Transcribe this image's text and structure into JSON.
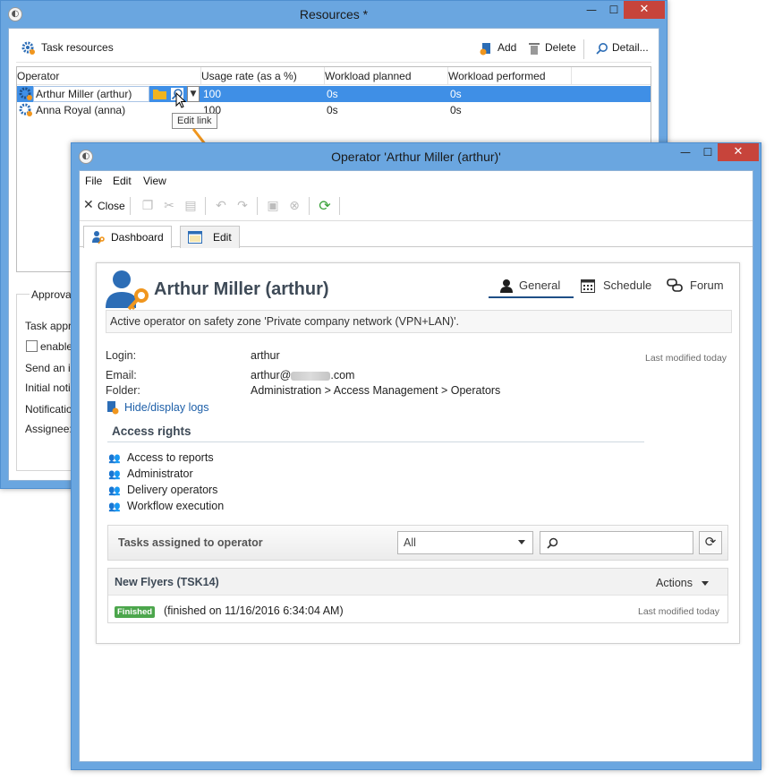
{
  "resources_window": {
    "title": "Resources *",
    "toolbar": {
      "task_resources": "Task resources",
      "add": "Add",
      "delete": "Delete",
      "detail": "Detail..."
    },
    "columns": [
      "Operator",
      "Usage rate (as a %)",
      "Workload planned",
      "Workload performed"
    ],
    "rows": [
      {
        "operator": "Arthur Miller (arthur)",
        "usage": "100",
        "planned": "0s",
        "performed": "0s"
      },
      {
        "operator": "Anna Royal (anna)",
        "usage": "100",
        "planned": "0s",
        "performed": "0s"
      }
    ],
    "tooltip": "Edit link",
    "approval": {
      "group": "Approval s",
      "task_appr": "Task appr",
      "enable": "enable",
      "send": "Send an in",
      "initial": "Initial noti",
      "notification": "Notificatio",
      "assignee": "Assignee:"
    }
  },
  "operator_window": {
    "title": "Operator 'Arthur Miller (arthur)'",
    "menu": [
      "File",
      "Edit",
      "View"
    ],
    "toolbar": {
      "close": "Close"
    },
    "tabs": {
      "dashboard": "Dashboard",
      "edit": "Edit"
    },
    "dashboard": {
      "name": "Arthur Miller (arthur)",
      "nav": {
        "general": "General",
        "schedule": "Schedule",
        "forum": "Forum"
      },
      "status": "Active operator on safety zone 'Private company network (VPN+LAN)'.",
      "login_label": "Login:",
      "login_value": "arthur",
      "last_modified": "Last modified today",
      "email_label": "Email:",
      "email_prefix": "arthur@",
      "email_suffix": ".com",
      "folder_label": "Folder:",
      "folder_value": "Administration > Access Management > Operators",
      "logs_link": "Hide/display logs",
      "access_rights_title": "Access rights",
      "access_rights": [
        "Access to reports",
        "Administrator",
        "Delivery operators",
        "Workflow execution"
      ],
      "tasks_title": "Tasks assigned to operator",
      "filter_value": "All",
      "task": {
        "name": "New Flyers (TSK14)",
        "actions": "Actions",
        "status_badge": "Finished",
        "finished_text": "(finished on 11/16/2016 6:34:04 AM)",
        "last_modified": "Last modified today"
      }
    }
  },
  "colors": {
    "accent": "#1d5fa8",
    "selection": "#3f8fe6",
    "arrow": "#f0961e",
    "badge": "#4ca64c"
  }
}
